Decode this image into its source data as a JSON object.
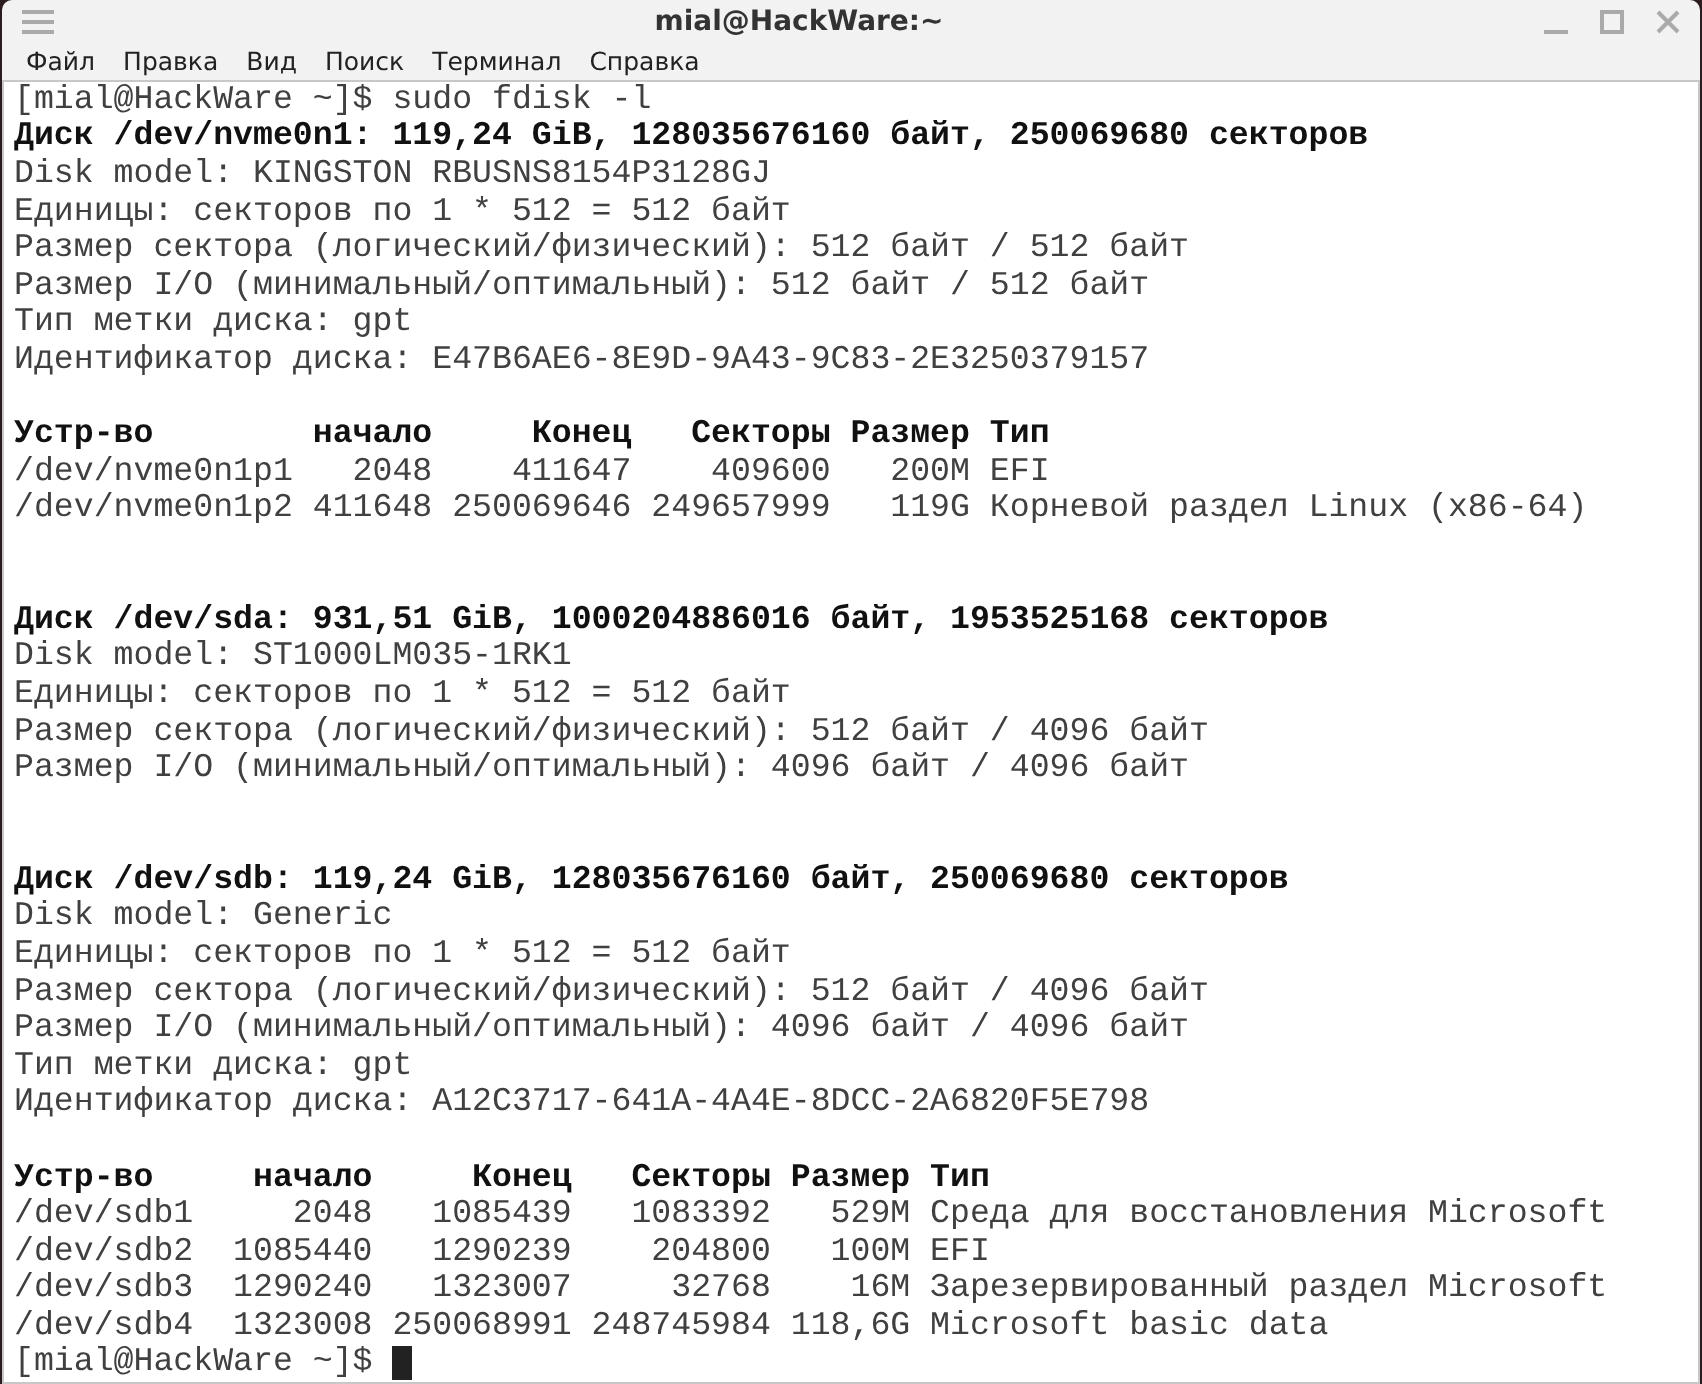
{
  "window": {
    "title": "mial@HackWare:~"
  },
  "menu": [
    "Файл",
    "Правка",
    "Вид",
    "Поиск",
    "Терминал",
    "Справка"
  ],
  "terminal": {
    "lines": [
      {
        "kind": "prompt",
        "text": "[mial@HackWare ~]$ sudo fdisk -l",
        "cursor": false
      },
      {
        "kind": "heading",
        "text": "Диск /dev/nvme0n1: 119,24 GiB, 128035676160 байт, 250069680 секторов"
      },
      {
        "kind": "text",
        "text": "Disk model: KINGSTON RBUSNS8154P3128GJ"
      },
      {
        "kind": "text",
        "text": "Единицы: секторов по 1 * 512 = 512 байт"
      },
      {
        "kind": "text",
        "text": "Размер сектора (логический/физический): 512 байт / 512 байт"
      },
      {
        "kind": "text",
        "text": "Размер I/O (минимальный/оптимальный): 512 байт / 512 байт"
      },
      {
        "kind": "text",
        "text": "Тип метки диска: gpt"
      },
      {
        "kind": "text",
        "text": "Идентификатор диска: E47B6AE6-8E9D-9A43-9C83-2E3250379157"
      },
      {
        "kind": "blank"
      },
      {
        "kind": "heading",
        "text": "Устр-во        начало     Конец   Секторы Размер Тип"
      },
      {
        "kind": "text",
        "text": "/dev/nvme0n1p1   2048    411647    409600   200M EFI"
      },
      {
        "kind": "text",
        "text": "/dev/nvme0n1p2 411648 250069646 249657999   119G Корневой раздел Linux (x86-64)"
      },
      {
        "kind": "blank"
      },
      {
        "kind": "blank"
      },
      {
        "kind": "heading",
        "text": "Диск /dev/sda: 931,51 GiB, 1000204886016 байт, 1953525168 секторов"
      },
      {
        "kind": "text",
        "text": "Disk model: ST1000LM035-1RK1"
      },
      {
        "kind": "text",
        "text": "Единицы: секторов по 1 * 512 = 512 байт"
      },
      {
        "kind": "text",
        "text": "Размер сектора (логический/физический): 512 байт / 4096 байт"
      },
      {
        "kind": "text",
        "text": "Размер I/O (минимальный/оптимальный): 4096 байт / 4096 байт"
      },
      {
        "kind": "blank"
      },
      {
        "kind": "blank"
      },
      {
        "kind": "heading",
        "text": "Диск /dev/sdb: 119,24 GiB, 128035676160 байт, 250069680 секторов"
      },
      {
        "kind": "text",
        "text": "Disk model: Generic"
      },
      {
        "kind": "text",
        "text": "Единицы: секторов по 1 * 512 = 512 байт"
      },
      {
        "kind": "text",
        "text": "Размер сектора (логический/физический): 512 байт / 4096 байт"
      },
      {
        "kind": "text",
        "text": "Размер I/O (минимальный/оптимальный): 4096 байт / 4096 байт"
      },
      {
        "kind": "text",
        "text": "Тип метки диска: gpt"
      },
      {
        "kind": "text",
        "text": "Идентификатор диска: A12C3717-641A-4A4E-8DCC-2A6820F5E798"
      },
      {
        "kind": "blank"
      },
      {
        "kind": "heading",
        "text": "Устр-во     начало     Конец   Секторы Размер Тип"
      },
      {
        "kind": "text",
        "text": "/dev/sdb1     2048   1085439   1083392   529M Среда для восстановления Microsoft"
      },
      {
        "kind": "text",
        "text": "/dev/sdb2  1085440   1290239    204800   100M EFI"
      },
      {
        "kind": "text",
        "text": "/dev/sdb3  1290240   1323007     32768    16M Зарезервированный раздел Microsoft"
      },
      {
        "kind": "text",
        "text": "/dev/sdb4  1323008 250068991 248745984 118,6G Microsoft basic data"
      },
      {
        "kind": "prompt",
        "text": "[mial@HackWare ~]$",
        "cursor": true
      }
    ]
  }
}
